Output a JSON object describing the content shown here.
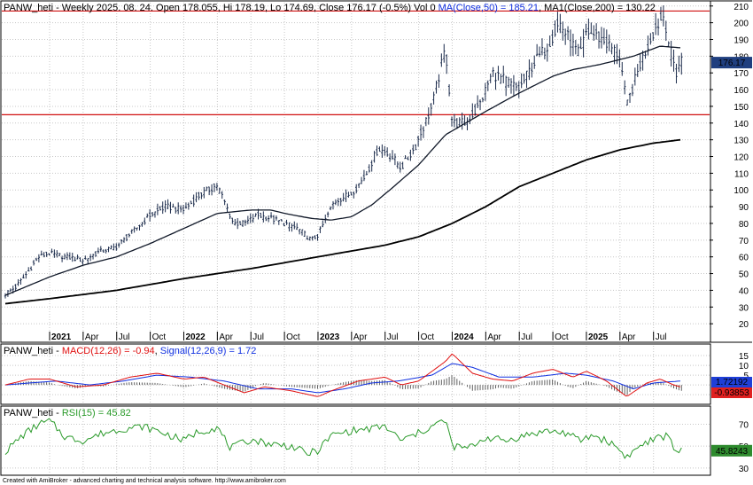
{
  "credit": "Created with AmiBroker - advanced charting and technical analysis software. http://www.amibroker.com",
  "colors": {
    "price_bars": "#1a2a4a",
    "ma50": "#101828",
    "ma200": "#000000",
    "hlines": "#d01010",
    "macd": "#e01010",
    "signal": "#1030e0",
    "hist": "#606060",
    "rsi": "#2a9a2a",
    "grid": "#c8c8c8",
    "last_price_badge": "#1f3f7f",
    "rsi_badge": "#2e8b2e",
    "macd_badge_blue": "#1f3fd8",
    "macd_badge_red": "#e02020"
  },
  "chart_data": [
    {
      "type": "candlestick",
      "panel": "price",
      "title_parts": {
        "main": "PANW_heti - Weekly 2025. 08. 24. Open 178.055, Hi 178.19, Lo 174.69, Close 176.17 (-0.5%) Vol 0 ",
        "ma50": "MA(Close,50) = 185.21",
        "sep": ", ",
        "ma200": "MA1(Close,200) = 130.22"
      },
      "ylim": [
        10,
        212
      ],
      "y_ticks": [
        "210",
        "200",
        "190",
        "180",
        "170",
        "160",
        "150",
        "140",
        "130",
        "120",
        "110",
        "100",
        "90",
        "80",
        "70",
        "60",
        "50",
        "40",
        "30",
        "20"
      ],
      "last_price": "176.17",
      "horizontal_lines": [
        207,
        145
      ],
      "x_labels": [
        {
          "label": "2021",
          "x": 2021.0,
          "bold": true
        },
        {
          "label": "Apr",
          "x": 2021.25
        },
        {
          "label": "Jul",
          "x": 2021.5
        },
        {
          "label": "Oct",
          "x": 2021.75
        },
        {
          "label": "2022",
          "x": 2022.0,
          "bold": true
        },
        {
          "label": "Apr",
          "x": 2022.25
        },
        {
          "label": "Jul",
          "x": 2022.5
        },
        {
          "label": "Oct",
          "x": 2022.75
        },
        {
          "label": "2023",
          "x": 2023.0,
          "bold": true
        },
        {
          "label": "Apr",
          "x": 2023.25
        },
        {
          "label": "Jul",
          "x": 2023.5
        },
        {
          "label": "Oct",
          "x": 2023.75
        },
        {
          "label": "2024",
          "x": 2024.0,
          "bold": true
        },
        {
          "label": "Apr",
          "x": 2024.25
        },
        {
          "label": "Jul",
          "x": 2024.5
        },
        {
          "label": "Oct",
          "x": 2024.75
        },
        {
          "label": "2025",
          "x": 2025.0,
          "bold": true
        },
        {
          "label": "Apr",
          "x": 2025.25
        },
        {
          "label": "Jul",
          "x": 2025.5
        }
      ],
      "price_knots": [
        [
          2020.67,
          38
        ],
        [
          2020.75,
          42
        ],
        [
          2020.83,
          50
        ],
        [
          2020.92,
          60
        ],
        [
          2021.0,
          62
        ],
        [
          2021.12,
          60
        ],
        [
          2021.25,
          58
        ],
        [
          2021.37,
          63
        ],
        [
          2021.5,
          66
        ],
        [
          2021.62,
          75
        ],
        [
          2021.75,
          85
        ],
        [
          2021.87,
          90
        ],
        [
          2022.0,
          88
        ],
        [
          2022.12,
          97
        ],
        [
          2022.25,
          103
        ],
        [
          2022.37,
          80
        ],
        [
          2022.45,
          80
        ],
        [
          2022.55,
          85
        ],
        [
          2022.65,
          83
        ],
        [
          2022.75,
          80
        ],
        [
          2022.85,
          77
        ],
        [
          2022.95,
          70
        ],
        [
          2023.0,
          73
        ],
        [
          2023.12,
          93
        ],
        [
          2023.25,
          98
        ],
        [
          2023.35,
          108
        ],
        [
          2023.45,
          125
        ],
        [
          2023.55,
          120
        ],
        [
          2023.62,
          113
        ],
        [
          2023.72,
          125
        ],
        [
          2023.85,
          150
        ],
        [
          2023.95,
          185
        ],
        [
          2024.0,
          140
        ],
        [
          2024.1,
          140
        ],
        [
          2024.2,
          150
        ],
        [
          2024.3,
          170
        ],
        [
          2024.4,
          165
        ],
        [
          2024.5,
          160
        ],
        [
          2024.6,
          175
        ],
        [
          2024.7,
          185
        ],
        [
          2024.8,
          200
        ],
        [
          2024.87,
          190
        ],
        [
          2024.95,
          180
        ],
        [
          2025.0,
          195
        ],
        [
          2025.12,
          190
        ],
        [
          2025.25,
          180
        ],
        [
          2025.3,
          150
        ],
        [
          2025.4,
          175
        ],
        [
          2025.5,
          195
        ],
        [
          2025.58,
          205
        ],
        [
          2025.62,
          185
        ],
        [
          2025.67,
          170
        ],
        [
          2025.7,
          178
        ]
      ],
      "ma50_knots": [
        [
          2020.67,
          37
        ],
        [
          2021.0,
          48
        ],
        [
          2021.25,
          55
        ],
        [
          2021.5,
          60
        ],
        [
          2021.75,
          68
        ],
        [
          2022.0,
          77
        ],
        [
          2022.25,
          86
        ],
        [
          2022.5,
          88
        ],
        [
          2022.65,
          88
        ],
        [
          2022.75,
          86
        ],
        [
          2022.95,
          83
        ],
        [
          2023.1,
          82
        ],
        [
          2023.25,
          84
        ],
        [
          2023.4,
          91
        ],
        [
          2023.55,
          101
        ],
        [
          2023.75,
          115
        ],
        [
          2023.95,
          133
        ],
        [
          2024.25,
          147
        ],
        [
          2024.5,
          158
        ],
        [
          2024.75,
          168
        ],
        [
          2024.9,
          172
        ],
        [
          2025.1,
          175
        ],
        [
          2025.35,
          180
        ],
        [
          2025.55,
          186
        ],
        [
          2025.7,
          185
        ]
      ],
      "ma200_knots": [
        [
          2020.67,
          32
        ],
        [
          2021.0,
          35
        ],
        [
          2021.5,
          40
        ],
        [
          2022.0,
          47
        ],
        [
          2022.5,
          53
        ],
        [
          2023.0,
          60
        ],
        [
          2023.5,
          67
        ],
        [
          2023.75,
          72
        ],
        [
          2024.0,
          80
        ],
        [
          2024.25,
          90
        ],
        [
          2024.5,
          102
        ],
        [
          2024.75,
          110
        ],
        [
          2025.0,
          118
        ],
        [
          2025.25,
          124
        ],
        [
          2025.5,
          128
        ],
        [
          2025.7,
          130
        ]
      ]
    },
    {
      "type": "line",
      "panel": "macd",
      "title_parts": {
        "main": "PANW_heti - ",
        "macd": "MACD(12,26) = -0.94",
        "sep": ", ",
        "signal": "Signal(12,26,9) = 1.72"
      },
      "ylim": [
        -9,
        20
      ],
      "y_ticks": [
        "15",
        "10",
        "5",
        "0",
        "-5"
      ],
      "macd_value": "-0.94",
      "signal_value": "1.72",
      "badge_signal": "1.72192",
      "badge_macd": "-0.93853",
      "macd_knots": [
        [
          2020.67,
          0
        ],
        [
          2020.85,
          3
        ],
        [
          2021.0,
          3
        ],
        [
          2021.2,
          -1
        ],
        [
          2021.4,
          0
        ],
        [
          2021.6,
          4
        ],
        [
          2021.8,
          6
        ],
        [
          2022.0,
          3
        ],
        [
          2022.15,
          4
        ],
        [
          2022.3,
          0
        ],
        [
          2022.45,
          -4
        ],
        [
          2022.6,
          -1
        ],
        [
          2022.8,
          -3
        ],
        [
          2023.0,
          -6
        ],
        [
          2023.1,
          -3
        ],
        [
          2023.3,
          2
        ],
        [
          2023.5,
          4
        ],
        [
          2023.62,
          0
        ],
        [
          2023.75,
          2
        ],
        [
          2023.85,
          7
        ],
        [
          2023.95,
          12
        ],
        [
          2024.0,
          16
        ],
        [
          2024.15,
          6
        ],
        [
          2024.3,
          3
        ],
        [
          2024.45,
          2
        ],
        [
          2024.6,
          6
        ],
        [
          2024.75,
          8
        ],
        [
          2024.9,
          4
        ],
        [
          2025.0,
          7
        ],
        [
          2025.15,
          2
        ],
        [
          2025.3,
          -6
        ],
        [
          2025.45,
          1
        ],
        [
          2025.55,
          3
        ],
        [
          2025.65,
          0
        ],
        [
          2025.7,
          -1
        ]
      ],
      "signal_knots": [
        [
          2020.67,
          0
        ],
        [
          2020.85,
          1
        ],
        [
          2021.05,
          2
        ],
        [
          2021.3,
          0
        ],
        [
          2021.55,
          2
        ],
        [
          2021.8,
          5
        ],
        [
          2022.05,
          4
        ],
        [
          2022.3,
          2
        ],
        [
          2022.55,
          -2
        ],
        [
          2022.8,
          -2
        ],
        [
          2023.0,
          -4
        ],
        [
          2023.2,
          -2
        ],
        [
          2023.4,
          1
        ],
        [
          2023.6,
          2
        ],
        [
          2023.85,
          5
        ],
        [
          2024.0,
          11
        ],
        [
          2024.15,
          9
        ],
        [
          2024.35,
          4
        ],
        [
          2024.6,
          4
        ],
        [
          2024.85,
          6
        ],
        [
          2025.0,
          5
        ],
        [
          2025.2,
          2
        ],
        [
          2025.35,
          -2
        ],
        [
          2025.5,
          1
        ],
        [
          2025.7,
          2
        ]
      ]
    },
    {
      "type": "line",
      "panel": "rsi",
      "title_parts": {
        "main": "PANW_heti - ",
        "rsi": "RSI(15) = 45.82"
      },
      "ylim": [
        25,
        85
      ],
      "y_ticks": [
        "70",
        "50",
        "30"
      ],
      "rsi_value": "45.82",
      "badge_rsi": "45.8243",
      "rsi_knots": [
        [
          2020.67,
          45
        ],
        [
          2020.8,
          60
        ],
        [
          2020.92,
          70
        ],
        [
          2021.0,
          73
        ],
        [
          2021.12,
          58
        ],
        [
          2021.25,
          55
        ],
        [
          2021.4,
          62
        ],
        [
          2021.55,
          66
        ],
        [
          2021.7,
          68
        ],
        [
          2021.85,
          62
        ],
        [
          2022.0,
          55
        ],
        [
          2022.1,
          63
        ],
        [
          2022.25,
          67
        ],
        [
          2022.35,
          48
        ],
        [
          2022.5,
          56
        ],
        [
          2022.65,
          52
        ],
        [
          2022.8,
          50
        ],
        [
          2022.92,
          43
        ],
        [
          2023.0,
          46
        ],
        [
          2023.1,
          60
        ],
        [
          2023.25,
          64
        ],
        [
          2023.4,
          66
        ],
        [
          2023.5,
          68
        ],
        [
          2023.62,
          55
        ],
        [
          2023.75,
          62
        ],
        [
          2023.88,
          70
        ],
        [
          2023.95,
          74
        ],
        [
          2024.0,
          50
        ],
        [
          2024.12,
          48
        ],
        [
          2024.25,
          58
        ],
        [
          2024.4,
          55
        ],
        [
          2024.55,
          60
        ],
        [
          2024.7,
          64
        ],
        [
          2024.85,
          62
        ],
        [
          2024.95,
          55
        ],
        [
          2025.05,
          60
        ],
        [
          2025.2,
          52
        ],
        [
          2025.3,
          40
        ],
        [
          2025.42,
          52
        ],
        [
          2025.55,
          58
        ],
        [
          2025.62,
          60
        ],
        [
          2025.66,
          46
        ],
        [
          2025.7,
          45.82
        ]
      ]
    }
  ]
}
